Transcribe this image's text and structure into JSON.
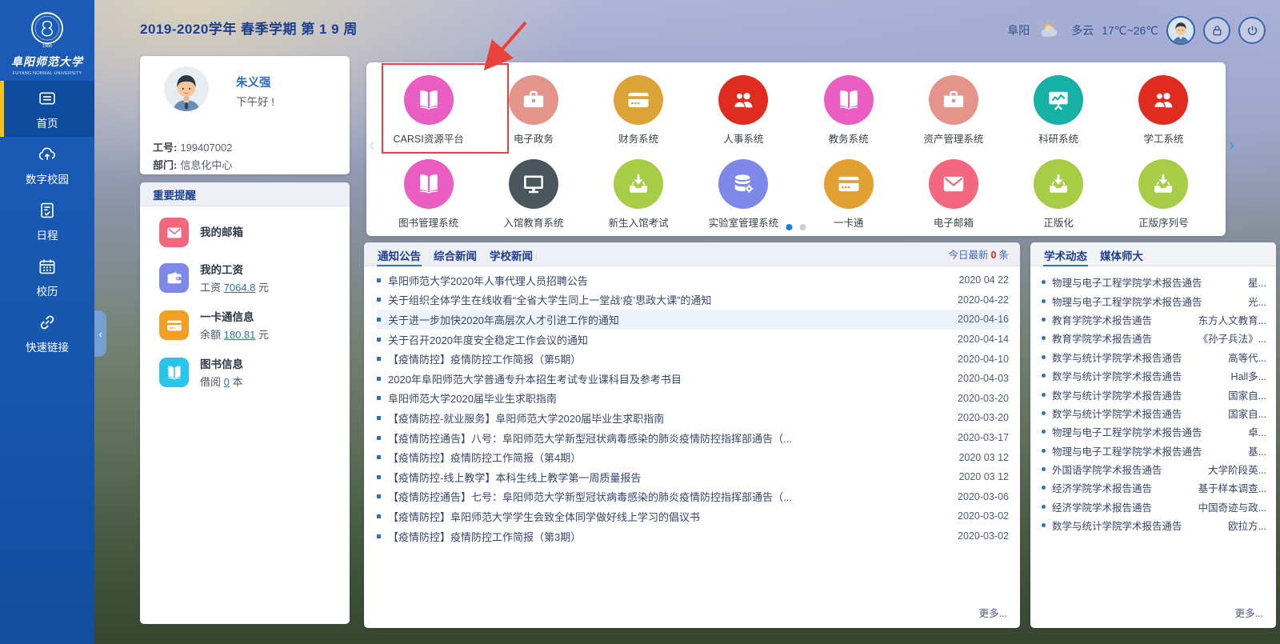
{
  "colors": {
    "accent_blue": "#2e6fc3",
    "sidebar_blue": "#1657b0",
    "active_tab_underline": "#2e6fc3",
    "alert_red": "#e8291c",
    "annotation_red": "#e8423a",
    "active_dot": "#1e7ce8"
  },
  "header": {
    "semester_title": "2019-2020学年 春季学期 第 1 9 周",
    "weather": {
      "city": "阜阳",
      "condition": "多云",
      "temperature": "17℃~26℃"
    }
  },
  "sidebar": {
    "logo": {
      "name_cn": "阜阳师范大学",
      "name_en": "FUYANG NORMAL UNIVERSITY",
      "year": "1956"
    },
    "collapse_glyph": "‹",
    "items": [
      {
        "key": "home",
        "label": "首页",
        "icon": "home-panel-icon",
        "active": true
      },
      {
        "key": "digital-campus",
        "label": "数字校园",
        "icon": "cloud-icon",
        "active": false
      },
      {
        "key": "schedule",
        "label": "日程",
        "icon": "schedule-icon",
        "active": false
      },
      {
        "key": "calendar",
        "label": "校历",
        "icon": "calendar-icon",
        "active": false
      },
      {
        "key": "quick-links",
        "label": "快速链接",
        "icon": "link-icon",
        "active": false
      }
    ]
  },
  "user_card": {
    "name": "朱义强",
    "greeting": "下午好 !",
    "id_label": "工号:",
    "id_value": "199407002",
    "dept_label": "部门:",
    "dept_value": "信息化中心"
  },
  "reminders": {
    "title": "重要提醒",
    "items": [
      {
        "key": "mailbox",
        "icon": "envelope-icon",
        "color": "#f4687f",
        "title": "我的邮箱",
        "prefix": "",
        "link": "",
        "suffix": ""
      },
      {
        "key": "salary",
        "icon": "salary-icon",
        "color": "#7d88e8",
        "title": "我的工资",
        "prefix": "工资 ",
        "link": "7064.8",
        "suffix": " 元"
      },
      {
        "key": "ecard",
        "icon": "bank-card-icon",
        "color": "#f0a125",
        "title": "一卡通信息",
        "prefix": "余额 ",
        "link": "180.81",
        "suffix": " 元"
      },
      {
        "key": "library",
        "icon": "open-book-icon",
        "color": "#29c5ea",
        "title": "图书信息",
        "prefix": "借阅 ",
        "link": "0",
        "suffix": " 本"
      }
    ]
  },
  "apps": {
    "items": [
      {
        "key": "carsi",
        "label": "CARSI资源平台",
        "icon": "open-book-icon",
        "color": "#ea5ec4",
        "highlighted": true
      },
      {
        "key": "e-gov",
        "label": "电子政务",
        "icon": "briefcase-icon",
        "color": "#e5948b",
        "highlighted": false
      },
      {
        "key": "finance",
        "label": "财务系统",
        "icon": "bank-card-icon",
        "color": "#dba338",
        "highlighted": false
      },
      {
        "key": "hr",
        "label": "人事系统",
        "icon": "people-icon",
        "color": "#e02c1e",
        "highlighted": false
      },
      {
        "key": "academic-affairs",
        "label": "教务系统",
        "icon": "open-book-icon",
        "color": "#ea5ec4",
        "highlighted": false
      },
      {
        "key": "assets",
        "label": "资产管理系统",
        "icon": "briefcase-icon",
        "color": "#e5948b",
        "highlighted": false
      },
      {
        "key": "research",
        "label": "科研系统",
        "icon": "research-board-icon",
        "color": "#17b0a4",
        "highlighted": false
      },
      {
        "key": "student-work",
        "label": "学工系统",
        "icon": "people-icon",
        "color": "#e02c1e",
        "highlighted": false
      },
      {
        "key": "library-mgmt",
        "label": "图书管理系统",
        "icon": "open-book-icon",
        "color": "#ea5ec4",
        "highlighted": false
      },
      {
        "key": "library-edu",
        "label": "入馆教育系统",
        "icon": "monitor-icon",
        "color": "#4b565c",
        "highlighted": false
      },
      {
        "key": "freshman-exam",
        "label": "新生入馆考试",
        "icon": "inbox-download-icon",
        "color": "#a7cc45",
        "highlighted": false
      },
      {
        "key": "lab-mgmt",
        "label": "实验室管理系统",
        "icon": "database-icon",
        "color": "#7d88e8",
        "highlighted": false
      },
      {
        "key": "onecard",
        "label": "一卡通",
        "icon": "bank-card-icon",
        "color": "#e3a032",
        "highlighted": false
      },
      {
        "key": "email",
        "label": "电子邮箱",
        "icon": "envelope-icon",
        "color": "#f4687f",
        "highlighted": false
      },
      {
        "key": "genuine-software",
        "label": "正版化",
        "icon": "inbox-download-icon",
        "color": "#a7cc45",
        "highlighted": false
      },
      {
        "key": "serial-number",
        "label": "正版序列号",
        "icon": "inbox-download-icon",
        "color": "#a7cc45",
        "highlighted": false
      }
    ],
    "pagination": {
      "dots": 2,
      "active": 0
    },
    "prev_glyph": "‹",
    "next_glyph": "›"
  },
  "notices": {
    "tabs": [
      {
        "key": "announcements",
        "label": "通知公告",
        "active": true
      },
      {
        "key": "general-news",
        "label": "综合新闻",
        "active": false
      },
      {
        "key": "school-news",
        "label": "学校新闻",
        "active": false
      }
    ],
    "today_label": "今日最新",
    "today_count": "0",
    "today_unit": "条",
    "more_label": "更多...",
    "items": [
      {
        "title": "阜阳师范大学2020年人事代理人员招聘公告",
        "date": "2020 04 22",
        "highlight": false
      },
      {
        "title": "关于组织全体学生在线收看“全省大学生同上一堂战‘疫’思政大课”的通知",
        "date": "2020-04-22",
        "highlight": false
      },
      {
        "title": "关于进一步加快2020年高层次人才引进工作的通知",
        "date": "2020-04-16",
        "highlight": true
      },
      {
        "title": "关于召开2020年度安全稳定工作会议的通知",
        "date": "2020-04-14",
        "highlight": false
      },
      {
        "title": "【疫情防控】疫情防控工作简报（第5期）",
        "date": "2020-04-10",
        "highlight": false
      },
      {
        "title": "2020年阜阳师范大学普通专升本招生考试专业课科目及参考书目",
        "date": "2020-04-03",
        "highlight": false
      },
      {
        "title": "阜阳师范大学2020届毕业生求职指南",
        "date": "2020-03-20",
        "highlight": false
      },
      {
        "title": "【疫情防控-就业服务】阜阳师范大学2020届毕业生求职指南",
        "date": "2020-03-20",
        "highlight": false
      },
      {
        "title": "【疫情防控通告】八号：阜阳师范大学新型冠状病毒感染的肺炎疫情防控指挥部通告（...",
        "date": "2020-03-17",
        "highlight": false
      },
      {
        "title": "【疫情防控】疫情防控工作简报（第4期）",
        "date": "2020 03 12",
        "highlight": false
      },
      {
        "title": "【疫情防控-线上教学】本科生线上教学第一周质量报告",
        "date": "2020 03 12",
        "highlight": false
      },
      {
        "title": "【疫情防控通告】七号：阜阳师范大学新型冠状病毒感染的肺炎疫情防控指挥部通告（...",
        "date": "2020-03-06",
        "highlight": false
      },
      {
        "title": "【疫情防控】阜阳师范大学学生会致全体同学做好线上学习的倡议书",
        "date": "2020-03-02",
        "highlight": false
      },
      {
        "title": "【疫情防控】疫情防控工作简报（第3期）",
        "date": "2020-03-02",
        "highlight": false
      }
    ]
  },
  "academic": {
    "tabs": [
      {
        "key": "academic-trends",
        "label": "学术动态",
        "active": true
      },
      {
        "key": "media",
        "label": "媒体师大",
        "active": false
      }
    ],
    "more_label": "更多...",
    "items": [
      {
        "title": "物理与电子工程学院学术报告通告",
        "snippet": "星..."
      },
      {
        "title": "物理与电子工程学院学术报告通告",
        "snippet": "光..."
      },
      {
        "title": "教育学院学术报告通告",
        "snippet": "东方人文教育..."
      },
      {
        "title": "教育学院学术报告通告",
        "snippet": "《孙子兵法》..."
      },
      {
        "title": "数学与统计学院学术报告通告",
        "snippet": "高等代..."
      },
      {
        "title": "数学与统计学院学术报告通告",
        "snippet": "Hall多..."
      },
      {
        "title": "数学与统计学院学术报告通告",
        "snippet": "国家自..."
      },
      {
        "title": "数学与统计学院学术报告通告",
        "snippet": "国家自..."
      },
      {
        "title": "物理与电子工程学院学术报告通告",
        "snippet": "卓..."
      },
      {
        "title": "物理与电子工程学院学术报告通告",
        "snippet": "基..."
      },
      {
        "title": "外国语学院学术报告通告",
        "snippet": "大学阶段英..."
      },
      {
        "title": "经济学院学术报告通告",
        "snippet": "基于样本调查..."
      },
      {
        "title": "经济学院学术报告通告",
        "snippet": "中国奇迹与政..."
      },
      {
        "title": "数学与统计学院学术报告通告",
        "snippet": "欧拉方..."
      }
    ]
  }
}
